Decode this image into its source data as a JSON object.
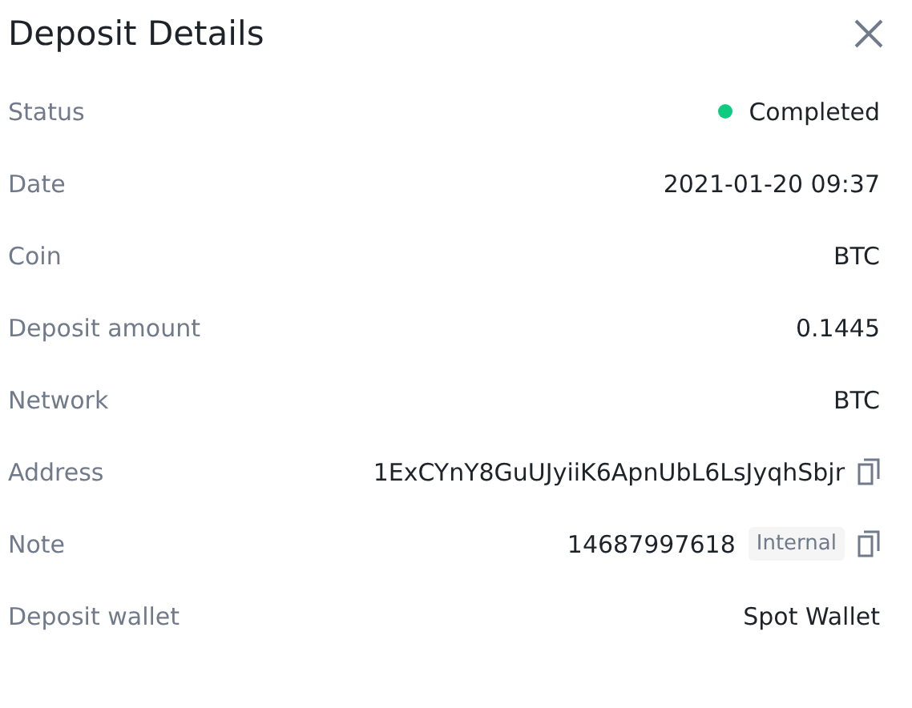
{
  "title": "Deposit Details",
  "rows": [
    {
      "kind": "status",
      "label": "Status",
      "value": "Completed",
      "color": "#0ecb81"
    },
    {
      "kind": "text",
      "label": "Date",
      "value": "2021-01-20 09:37"
    },
    {
      "kind": "text",
      "label": "Coin",
      "value": "BTC"
    },
    {
      "kind": "text",
      "label": "Deposit amount",
      "value": "0.1445"
    },
    {
      "kind": "text",
      "label": "Network",
      "value": "BTC"
    },
    {
      "kind": "copy",
      "label": "Address",
      "value": "1ExCYnY8GuUJyiiK6ApnUbL6LsJyqhSbjr"
    },
    {
      "kind": "tagged",
      "label": "Note",
      "value": "14687997618",
      "tag": "Internal"
    },
    {
      "kind": "text",
      "label": "Deposit wallet",
      "value": "Spot Wallet"
    }
  ]
}
